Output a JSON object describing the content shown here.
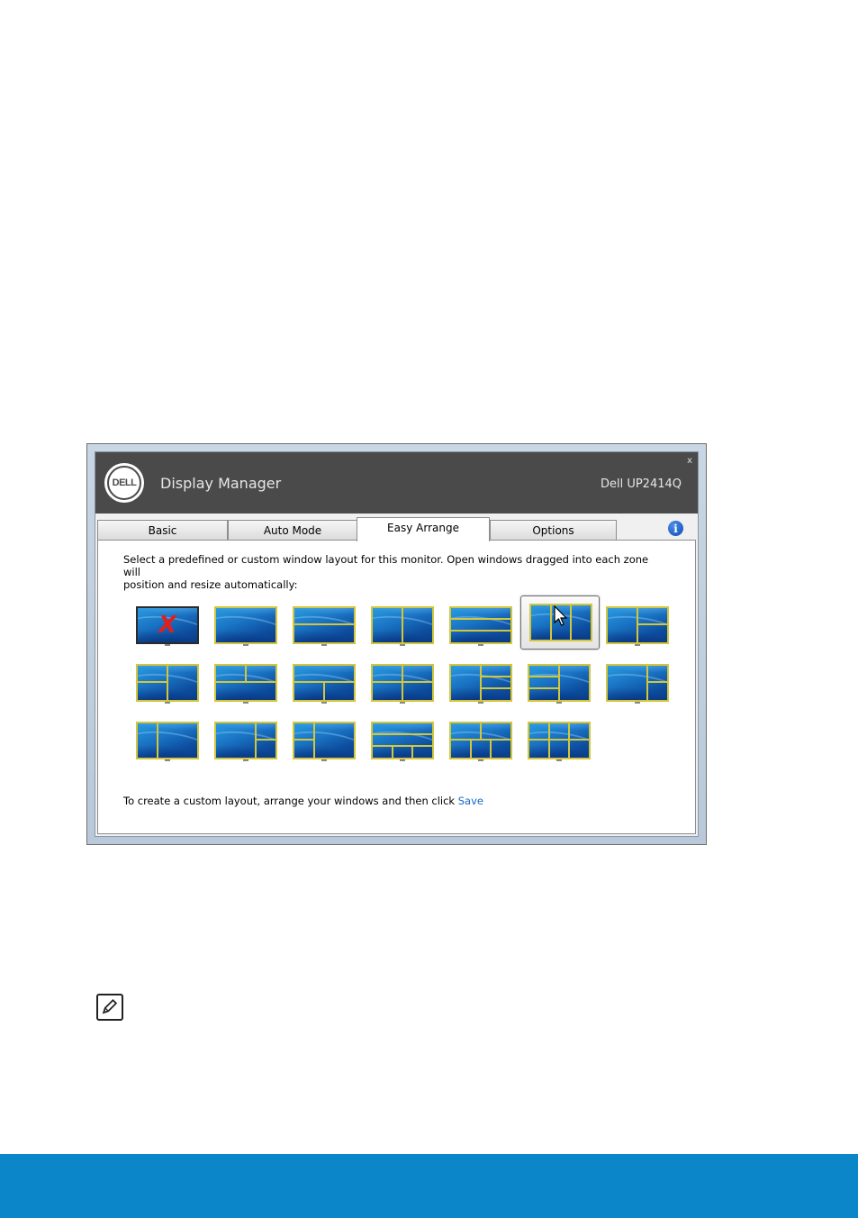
{
  "window": {
    "title": "Display Manager",
    "model": "Dell UP2414Q",
    "close_label": "x",
    "logo_text": "DELL"
  },
  "tabs": [
    {
      "label": "Basic"
    },
    {
      "label": "Auto Mode"
    },
    {
      "label": "Easy Arrange",
      "active": true
    },
    {
      "label": "Options"
    }
  ],
  "info_icon": "i",
  "panel": {
    "description_line1": "Select a predefined or custom window layout for this monitor. Open windows dragged into each zone will",
    "description_line2": "position and resize automatically:",
    "footer_text": "To create a custom layout, arrange your windows and then click ",
    "save_label": "Save"
  },
  "layouts": {
    "selected_index": 5,
    "none_mark": "X",
    "count": 20
  },
  "colors": {
    "accent_bar": "#0b86c9",
    "titlebar": "#4a4a4a",
    "zone_divider": "#d4c63a",
    "link": "#1a66c7"
  }
}
